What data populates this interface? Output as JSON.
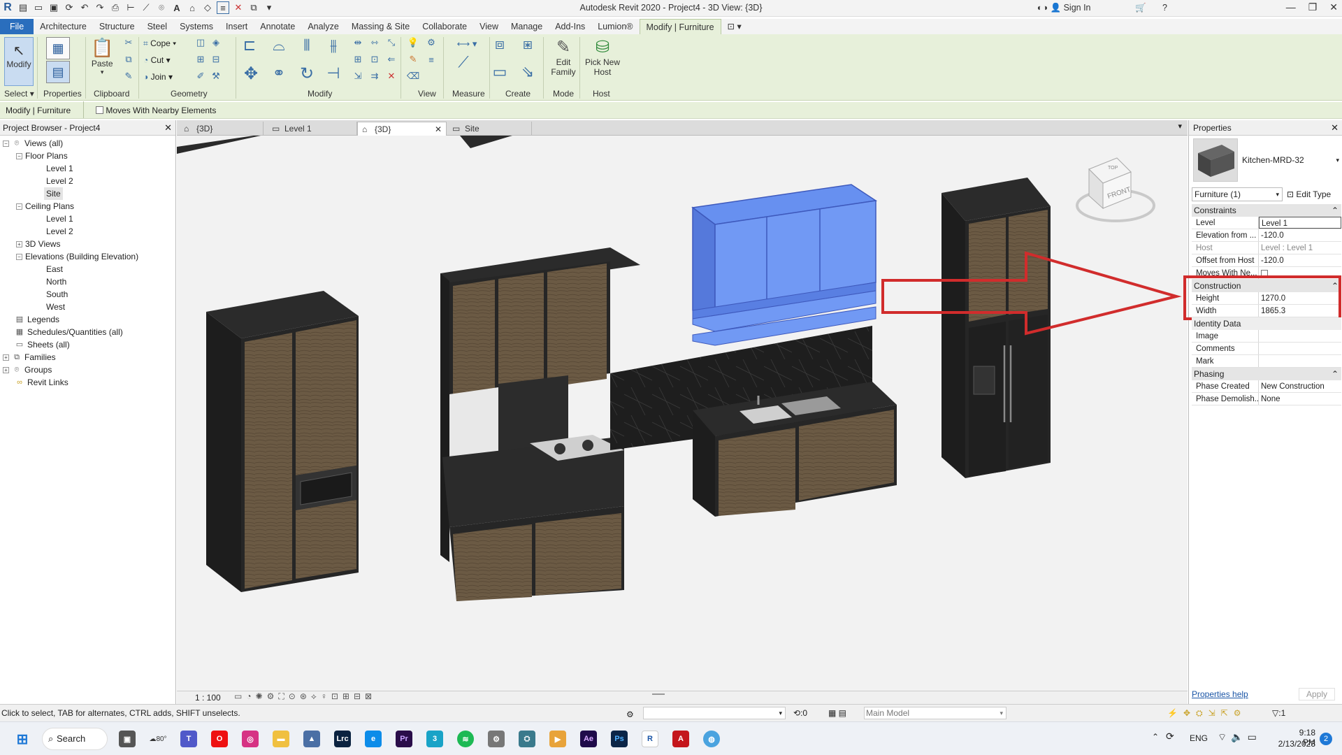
{
  "titlebar": {
    "title": "Autodesk Revit 2020 - Project4 - 3D View: {3D}",
    "sign_in": "Sign In"
  },
  "menubar": {
    "tabs": [
      "File",
      "Architecture",
      "Structure",
      "Steel",
      "Systems",
      "Insert",
      "Annotate",
      "Analyze",
      "Massing & Site",
      "Collaborate",
      "View",
      "Manage",
      "Add-Ins",
      "Lumion®",
      "Modify | Furniture"
    ]
  },
  "ribbon": {
    "select": {
      "modify": "Modify",
      "select": "Select"
    },
    "properties": "Properties",
    "clipboard": {
      "paste": "Paste",
      "label": "Clipboard"
    },
    "geometry": {
      "cope": "Cope",
      "cut": "Cut",
      "join": "Join",
      "label": "Geometry"
    },
    "modify_label": "Modify",
    "view_label": "View",
    "measure_label": "Measure",
    "create_label": "Create",
    "mode": {
      "edit_family": "Edit Family",
      "label": "Mode"
    },
    "host": {
      "pick_new_host": "Pick New Host",
      "label": "Host"
    }
  },
  "optionsbar": {
    "context": "Modify | Furniture",
    "moves_with": "Moves With Nearby Elements"
  },
  "project_browser": {
    "title": "Project Browser - Project4",
    "items": [
      {
        "label": "Views (all)"
      },
      {
        "label": "Floor Plans"
      },
      {
        "label": "Level 1"
      },
      {
        "label": "Level 2"
      },
      {
        "label": "Site"
      },
      {
        "label": "Ceiling Plans"
      },
      {
        "label": "Level 1"
      },
      {
        "label": "Level 2"
      },
      {
        "label": "3D Views"
      },
      {
        "label": "Elevations (Building Elevation)"
      },
      {
        "label": "East"
      },
      {
        "label": "North"
      },
      {
        "label": "South"
      },
      {
        "label": "West"
      },
      {
        "label": "Legends"
      },
      {
        "label": "Schedules/Quantities (all)"
      },
      {
        "label": "Sheets (all)"
      },
      {
        "label": "Families"
      },
      {
        "label": "Groups"
      },
      {
        "label": "Revit Links"
      }
    ]
  },
  "view_tabs": [
    {
      "label": "{3D}"
    },
    {
      "label": "Level 1"
    },
    {
      "label": "{3D}"
    },
    {
      "label": "Site"
    }
  ],
  "viewcube": {
    "top": "TOP",
    "front": "FRONT"
  },
  "view_bar": {
    "scale": "1 : 100"
  },
  "properties": {
    "title": "Properties",
    "type_name": "Kitchen-MRD-32",
    "selector": "Furniture (1)",
    "edit_type": "Edit Type",
    "groups": {
      "constraints": "Constraints",
      "construction": "Construction",
      "identity": "Identity Data",
      "phasing": "Phasing"
    },
    "rows": {
      "level": {
        "k": "Level",
        "v": "Level 1"
      },
      "elevation": {
        "k": "Elevation from ...",
        "v": "-120.0"
      },
      "host": {
        "k": "Host",
        "v": "Level : Level 1"
      },
      "offset": {
        "k": "Offset from Host",
        "v": "-120.0"
      },
      "moves": {
        "k": "Moves With Ne..."
      },
      "height": {
        "k": "Height",
        "v": "1270.0"
      },
      "width": {
        "k": "Width",
        "v": "1865.3"
      },
      "image": {
        "k": "Image"
      },
      "comments": {
        "k": "Comments"
      },
      "mark": {
        "k": "Mark"
      },
      "phase_created": {
        "k": "Phase Created",
        "v": "New Construction"
      },
      "phase_demolished": {
        "k": "Phase Demolish...",
        "v": "None"
      }
    },
    "help": "Properties help",
    "apply": "Apply"
  },
  "status": {
    "hint": "Click to select, TAB for alternates, CTRL adds, SHIFT unselects.",
    "count": ":0",
    "model": "Main Model",
    "filter": ":1"
  },
  "taskbar": {
    "search": "Search",
    "temp": "80°",
    "lang": "ENG",
    "time": "9:18 PM",
    "date": "2/13/2023",
    "badge": "2"
  },
  "colors": {
    "ribbon_bg": "#e7f0da",
    "file_tab": "#2a6ebd",
    "highlight_red": "#d12c2c",
    "selection_blue": "#3d6fe0"
  }
}
